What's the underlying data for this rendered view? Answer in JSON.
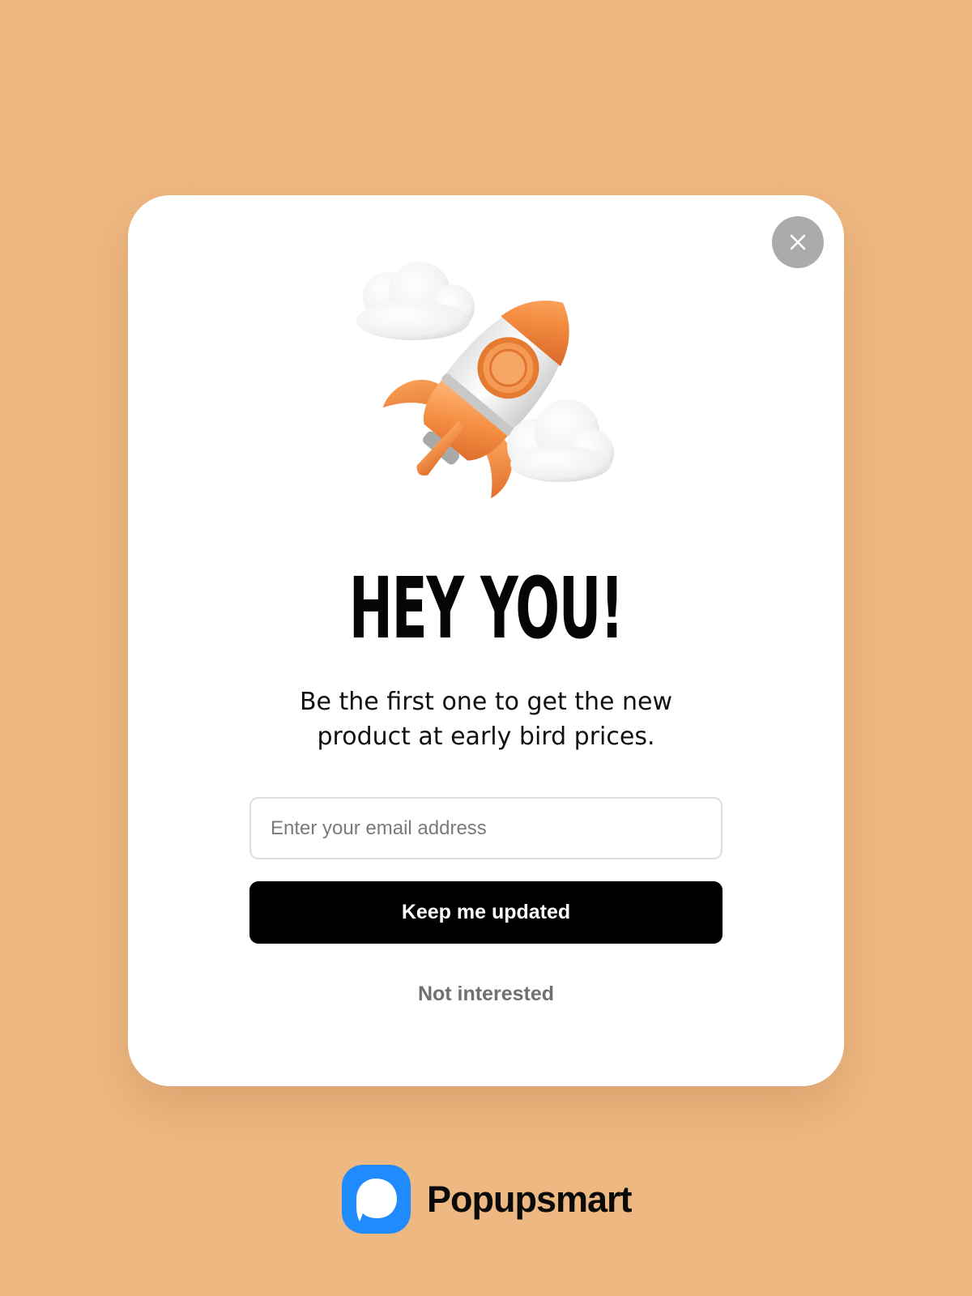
{
  "theme": {
    "page_background": "#EEB883",
    "accent": "#F08A3C",
    "button_background": "#000000",
    "close_button_background": "#ABABAB",
    "brand_blue": "#1F8BFF"
  },
  "modal": {
    "close_icon": "close-icon",
    "hero_image": "rocket-with-clouds-illustration",
    "headline": "HEY YOU!",
    "subtitle": "Be the first one to get the new product at early bird prices.",
    "email_placeholder": "Enter your email address",
    "email_value": "",
    "submit_label": "Keep me updated",
    "dismiss_label": "Not interested"
  },
  "brand": {
    "logo_icon": "popupsmart-logo-icon",
    "name": "Popupsmart"
  }
}
